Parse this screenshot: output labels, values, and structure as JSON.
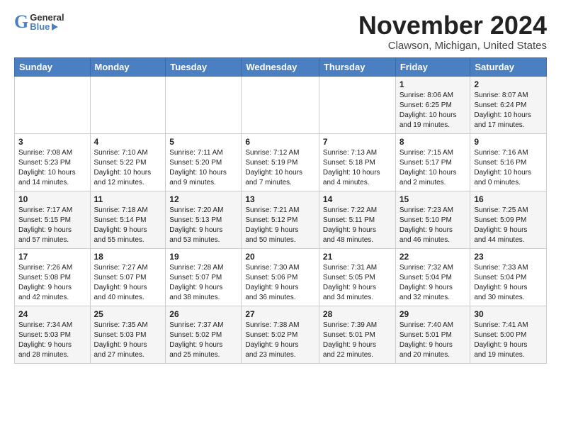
{
  "header": {
    "logo_general": "General",
    "logo_blue": "Blue",
    "month": "November 2024",
    "location": "Clawson, Michigan, United States"
  },
  "days_of_week": [
    "Sunday",
    "Monday",
    "Tuesday",
    "Wednesday",
    "Thursday",
    "Friday",
    "Saturday"
  ],
  "weeks": [
    [
      {
        "day": "",
        "info": ""
      },
      {
        "day": "",
        "info": ""
      },
      {
        "day": "",
        "info": ""
      },
      {
        "day": "",
        "info": ""
      },
      {
        "day": "",
        "info": ""
      },
      {
        "day": "1",
        "info": "Sunrise: 8:06 AM\nSunset: 6:25 PM\nDaylight: 10 hours\nand 19 minutes."
      },
      {
        "day": "2",
        "info": "Sunrise: 8:07 AM\nSunset: 6:24 PM\nDaylight: 10 hours\nand 17 minutes."
      }
    ],
    [
      {
        "day": "3",
        "info": "Sunrise: 7:08 AM\nSunset: 5:23 PM\nDaylight: 10 hours\nand 14 minutes."
      },
      {
        "day": "4",
        "info": "Sunrise: 7:10 AM\nSunset: 5:22 PM\nDaylight: 10 hours\nand 12 minutes."
      },
      {
        "day": "5",
        "info": "Sunrise: 7:11 AM\nSunset: 5:20 PM\nDaylight: 10 hours\nand 9 minutes."
      },
      {
        "day": "6",
        "info": "Sunrise: 7:12 AM\nSunset: 5:19 PM\nDaylight: 10 hours\nand 7 minutes."
      },
      {
        "day": "7",
        "info": "Sunrise: 7:13 AM\nSunset: 5:18 PM\nDaylight: 10 hours\nand 4 minutes."
      },
      {
        "day": "8",
        "info": "Sunrise: 7:15 AM\nSunset: 5:17 PM\nDaylight: 10 hours\nand 2 minutes."
      },
      {
        "day": "9",
        "info": "Sunrise: 7:16 AM\nSunset: 5:16 PM\nDaylight: 10 hours\nand 0 minutes."
      }
    ],
    [
      {
        "day": "10",
        "info": "Sunrise: 7:17 AM\nSunset: 5:15 PM\nDaylight: 9 hours\nand 57 minutes."
      },
      {
        "day": "11",
        "info": "Sunrise: 7:18 AM\nSunset: 5:14 PM\nDaylight: 9 hours\nand 55 minutes."
      },
      {
        "day": "12",
        "info": "Sunrise: 7:20 AM\nSunset: 5:13 PM\nDaylight: 9 hours\nand 53 minutes."
      },
      {
        "day": "13",
        "info": "Sunrise: 7:21 AM\nSunset: 5:12 PM\nDaylight: 9 hours\nand 50 minutes."
      },
      {
        "day": "14",
        "info": "Sunrise: 7:22 AM\nSunset: 5:11 PM\nDaylight: 9 hours\nand 48 minutes."
      },
      {
        "day": "15",
        "info": "Sunrise: 7:23 AM\nSunset: 5:10 PM\nDaylight: 9 hours\nand 46 minutes."
      },
      {
        "day": "16",
        "info": "Sunrise: 7:25 AM\nSunset: 5:09 PM\nDaylight: 9 hours\nand 44 minutes."
      }
    ],
    [
      {
        "day": "17",
        "info": "Sunrise: 7:26 AM\nSunset: 5:08 PM\nDaylight: 9 hours\nand 42 minutes."
      },
      {
        "day": "18",
        "info": "Sunrise: 7:27 AM\nSunset: 5:07 PM\nDaylight: 9 hours\nand 40 minutes."
      },
      {
        "day": "19",
        "info": "Sunrise: 7:28 AM\nSunset: 5:07 PM\nDaylight: 9 hours\nand 38 minutes."
      },
      {
        "day": "20",
        "info": "Sunrise: 7:30 AM\nSunset: 5:06 PM\nDaylight: 9 hours\nand 36 minutes."
      },
      {
        "day": "21",
        "info": "Sunrise: 7:31 AM\nSunset: 5:05 PM\nDaylight: 9 hours\nand 34 minutes."
      },
      {
        "day": "22",
        "info": "Sunrise: 7:32 AM\nSunset: 5:04 PM\nDaylight: 9 hours\nand 32 minutes."
      },
      {
        "day": "23",
        "info": "Sunrise: 7:33 AM\nSunset: 5:04 PM\nDaylight: 9 hours\nand 30 minutes."
      }
    ],
    [
      {
        "day": "24",
        "info": "Sunrise: 7:34 AM\nSunset: 5:03 PM\nDaylight: 9 hours\nand 28 minutes."
      },
      {
        "day": "25",
        "info": "Sunrise: 7:35 AM\nSunset: 5:03 PM\nDaylight: 9 hours\nand 27 minutes."
      },
      {
        "day": "26",
        "info": "Sunrise: 7:37 AM\nSunset: 5:02 PM\nDaylight: 9 hours\nand 25 minutes."
      },
      {
        "day": "27",
        "info": "Sunrise: 7:38 AM\nSunset: 5:02 PM\nDaylight: 9 hours\nand 23 minutes."
      },
      {
        "day": "28",
        "info": "Sunrise: 7:39 AM\nSunset: 5:01 PM\nDaylight: 9 hours\nand 22 minutes."
      },
      {
        "day": "29",
        "info": "Sunrise: 7:40 AM\nSunset: 5:01 PM\nDaylight: 9 hours\nand 20 minutes."
      },
      {
        "day": "30",
        "info": "Sunrise: 7:41 AM\nSunset: 5:00 PM\nDaylight: 9 hours\nand 19 minutes."
      }
    ]
  ]
}
